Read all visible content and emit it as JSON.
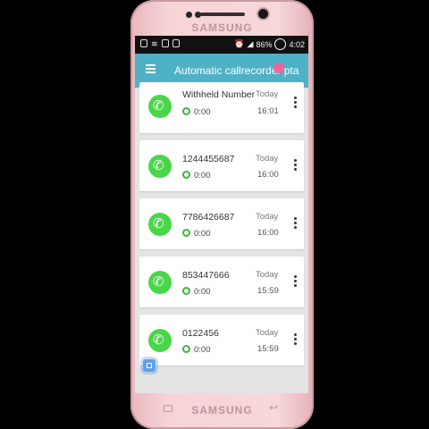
{
  "device": {
    "brand_top": "SAMSUNG",
    "brand_bottom": "SAMSUNG"
  },
  "status_bar": {
    "battery_percent": "86%",
    "clock": "4:02",
    "icons": [
      "sim-icon",
      "wifi-icon",
      "image-icon",
      "notification-icon",
      "alarm-icon",
      "signal-icon",
      "battery-icon"
    ]
  },
  "app_bar": {
    "title": "Automatic callrecorder pta",
    "menu_icon": "hamburger-menu-icon",
    "accent": "#4fb1c5"
  },
  "calls": [
    {
      "name": "Withheld Number",
      "duration": "0:00",
      "day": "Today",
      "time": "16:01"
    },
    {
      "name": "1244455687",
      "duration": "0:00",
      "day": "Today",
      "time": "16:00"
    },
    {
      "name": "7786426687",
      "duration": "0:00",
      "day": "Today",
      "time": "16:00"
    },
    {
      "name": "853447666",
      "duration": "0:00",
      "day": "Today",
      "time": "15:59"
    },
    {
      "name": "0122456",
      "duration": "0:00",
      "day": "Today",
      "time": "15:59"
    }
  ],
  "colors": {
    "avatar": "#49d649",
    "duration_icon": "#3bb53b"
  }
}
